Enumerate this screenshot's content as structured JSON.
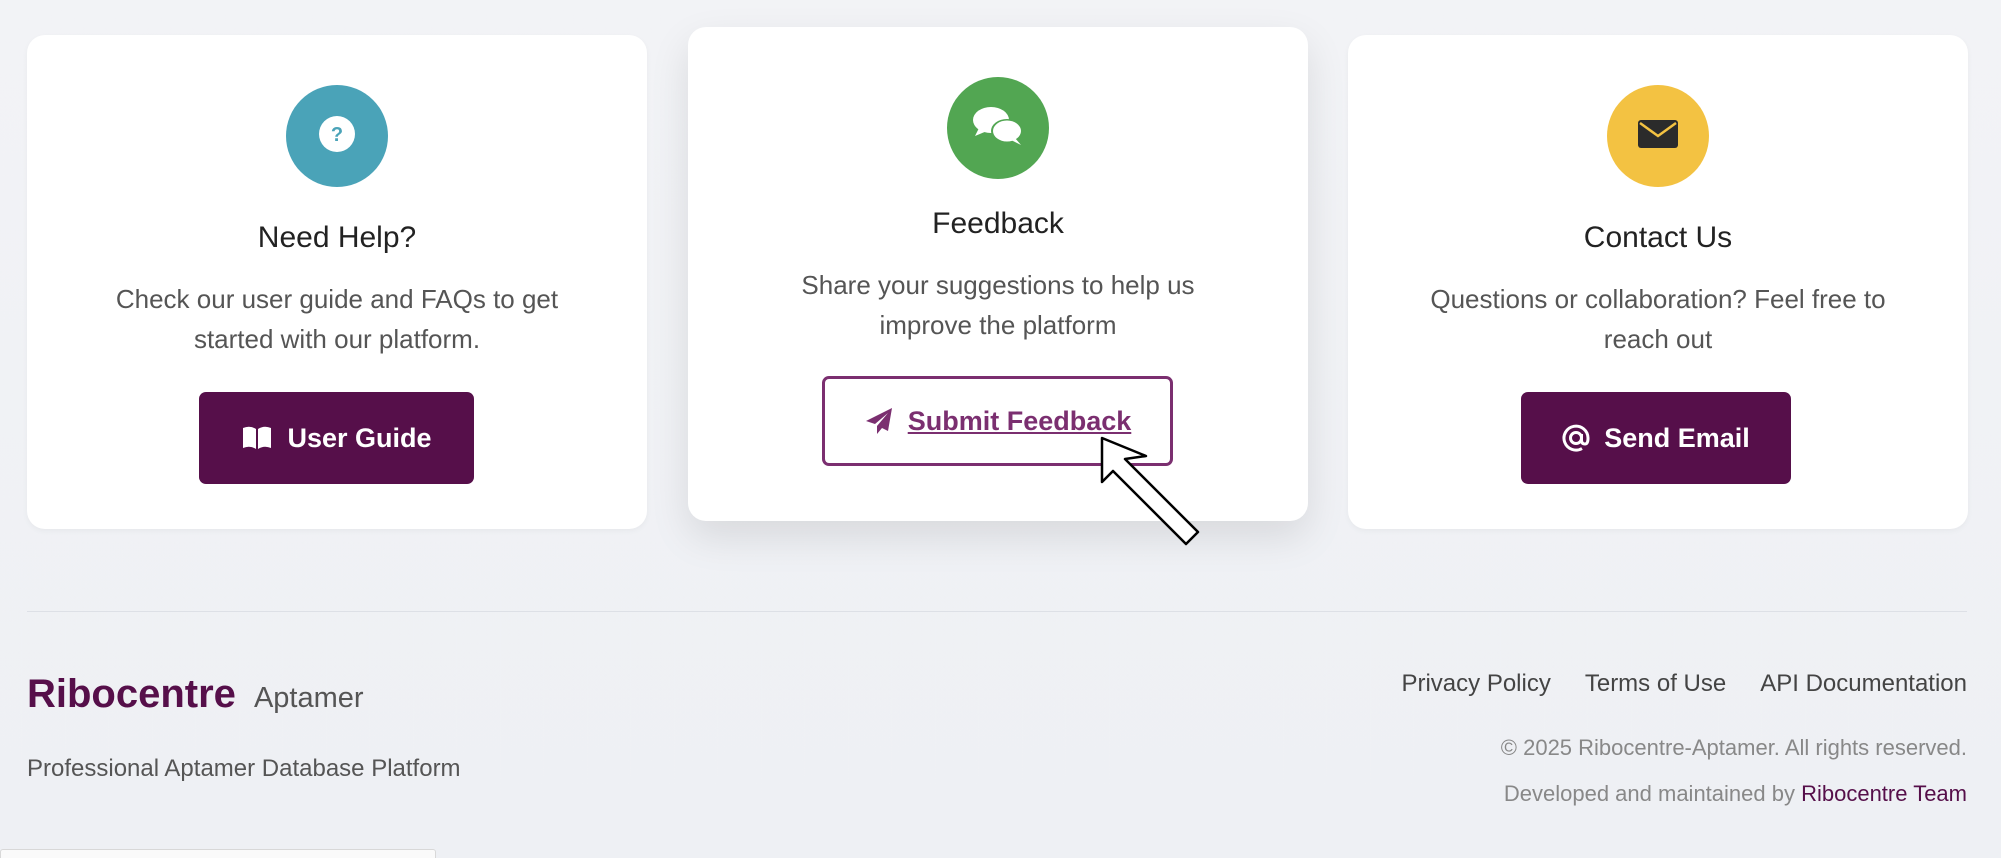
{
  "cards": [
    {
      "title": "Need Help?",
      "description": "Check our user guide and FAQs to get started with our platform.",
      "button_label": "User Guide",
      "icon": "question-icon",
      "button_icon": "book-icon",
      "color": "#4aa3b8"
    },
    {
      "title": "Feedback",
      "description": "Share your suggestions to help us improve the platform",
      "button_label": "Submit Feedback",
      "icon": "comments-icon",
      "button_icon": "paper-plane-icon",
      "color": "#52a652"
    },
    {
      "title": "Contact Us",
      "description": "Questions or collaboration? Feel free to reach out",
      "button_label": "Send Email",
      "icon": "envelope-icon",
      "button_icon": "at-icon",
      "color": "#f3c242"
    }
  ],
  "footer": {
    "brand_name": "Ribocentre",
    "brand_sub": "Aptamer",
    "tagline": "Professional Aptamer Database Platform",
    "links": [
      "Privacy Policy",
      "Terms of Use",
      "API Documentation"
    ],
    "copyright": "© 2025 Ribocentre-Aptamer. All rights reserved.",
    "developed_prefix": "Developed and maintained by",
    "developed_team": "Ribocentre Team"
  },
  "colors": {
    "brand": "#560f4a",
    "outline_button": "#7b2f70"
  }
}
